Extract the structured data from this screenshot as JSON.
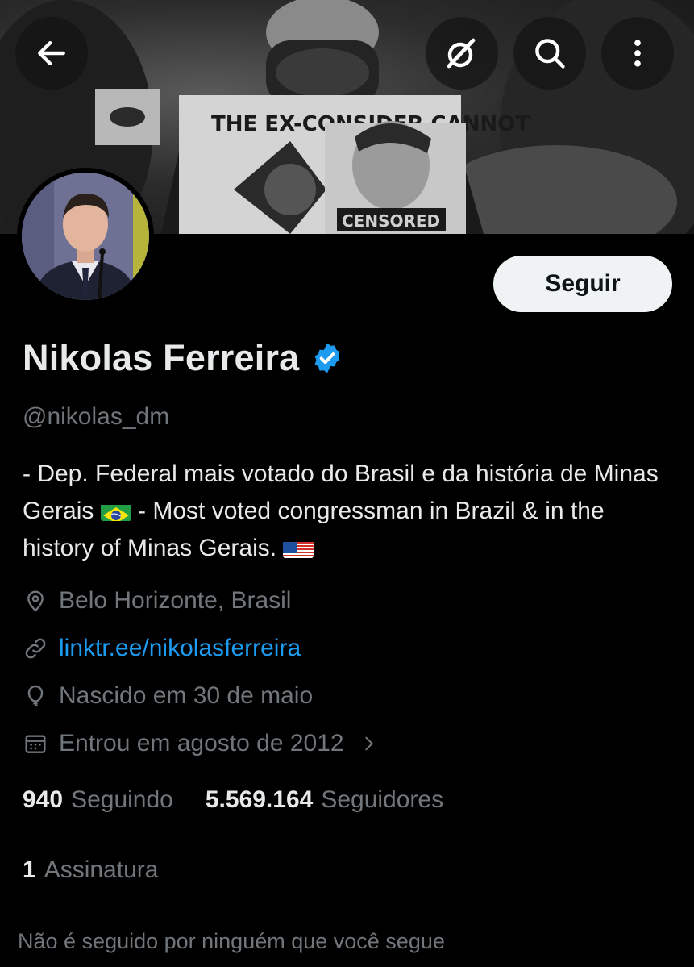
{
  "banner": {
    "sign_text": "THE EX-CONSIDER CANNOT",
    "poster_text": "CENSORED"
  },
  "header": {
    "back_icon": "arrow-left-icon",
    "grok_icon": "grok-icon",
    "search_icon": "search-icon",
    "more_icon": "more-vertical-icon"
  },
  "profile": {
    "follow_label": "Seguir",
    "name": "Nikolas Ferreira",
    "handle": "@nikolas_dm",
    "verified_color": "#1d9bf0",
    "bio_part1": "- Dep. Federal mais votado do Brasil e da história de Minas Gerais",
    "bio_part2": "- Most voted congressman in Brazil & in the history of Minas Gerais.",
    "location": "Belo Horizonte, Brasil",
    "website": "linktr.ee/nikolasferreira",
    "birthday": "Nascido em 30 de maio",
    "joined": "Entrou em agosto de 2012"
  },
  "stats": {
    "following_count": "940",
    "following_label": "Seguindo",
    "followers_count": "5.569.164",
    "followers_label": "Seguidores",
    "subscriptions_count": "1",
    "subscriptions_label": "Assinatura"
  },
  "footer": {
    "followed_by_text": "Não é seguido por ninguém que você segue"
  },
  "colors": {
    "background": "#000000",
    "text_primary": "#e7e9ea",
    "text_secondary": "#71767b",
    "link": "#1d9bf0"
  }
}
